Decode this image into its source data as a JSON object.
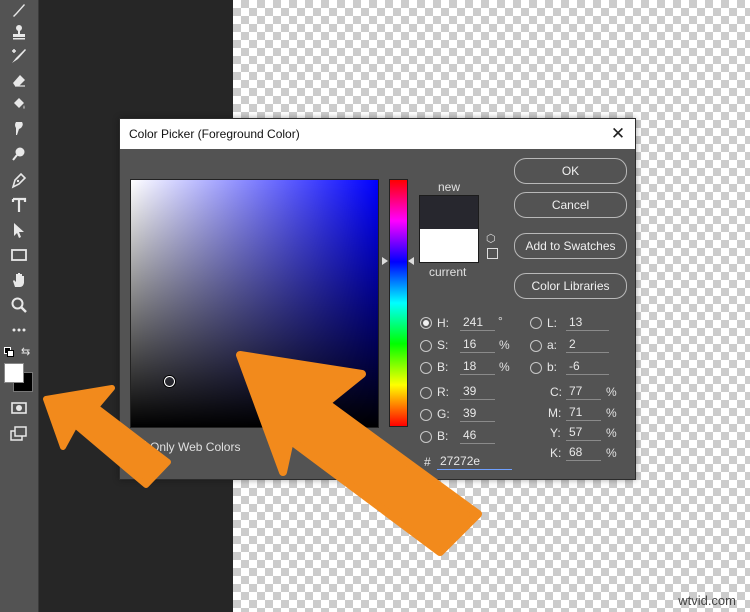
{
  "dialog": {
    "title": "Color Picker (Foreground Color)",
    "close_icon": "close-icon",
    "new_label": "new",
    "current_label": "current",
    "new_color": "#27272e",
    "current_color": "#ffffff",
    "only_web_colors_label": "Only Web Colors",
    "hex_prefix": "#",
    "hex_value": "27272e"
  },
  "buttons": {
    "ok": "OK",
    "cancel": "Cancel",
    "add_to_swatches": "Add to Swatches",
    "color_libraries": "Color Libraries"
  },
  "fields": {
    "H": {
      "label": "H:",
      "value": "241",
      "unit": "°"
    },
    "S": {
      "label": "S:",
      "value": "16",
      "unit": "%"
    },
    "B": {
      "label": "B:",
      "value": "18",
      "unit": "%"
    },
    "R": {
      "label": "R:",
      "value": "39"
    },
    "G": {
      "label": "G:",
      "value": "39"
    },
    "Bl": {
      "label": "B:",
      "value": "46"
    },
    "L": {
      "label": "L:",
      "value": "13"
    },
    "a": {
      "label": "a:",
      "value": "2"
    },
    "b": {
      "label": "b:",
      "value": "-6"
    },
    "C": {
      "label": "C:",
      "value": "77",
      "unit": "%"
    },
    "M": {
      "label": "M:",
      "value": "71",
      "unit": "%"
    },
    "Y": {
      "label": "Y:",
      "value": "57",
      "unit": "%"
    },
    "K": {
      "label": "K:",
      "value": "68",
      "unit": "%"
    }
  },
  "tools": [
    "brush-icon",
    "stamp-icon",
    "history-brush-icon",
    "eraser-icon",
    "paint-bucket-icon",
    "smudge-icon",
    "dodge-icon",
    "pen-icon",
    "type-icon",
    "path-selection-icon",
    "rectangle-icon",
    "hand-icon",
    "zoom-icon",
    "more-tools-icon"
  ],
  "watermark": "wtvid.com",
  "accent_color": "#f28a1c"
}
